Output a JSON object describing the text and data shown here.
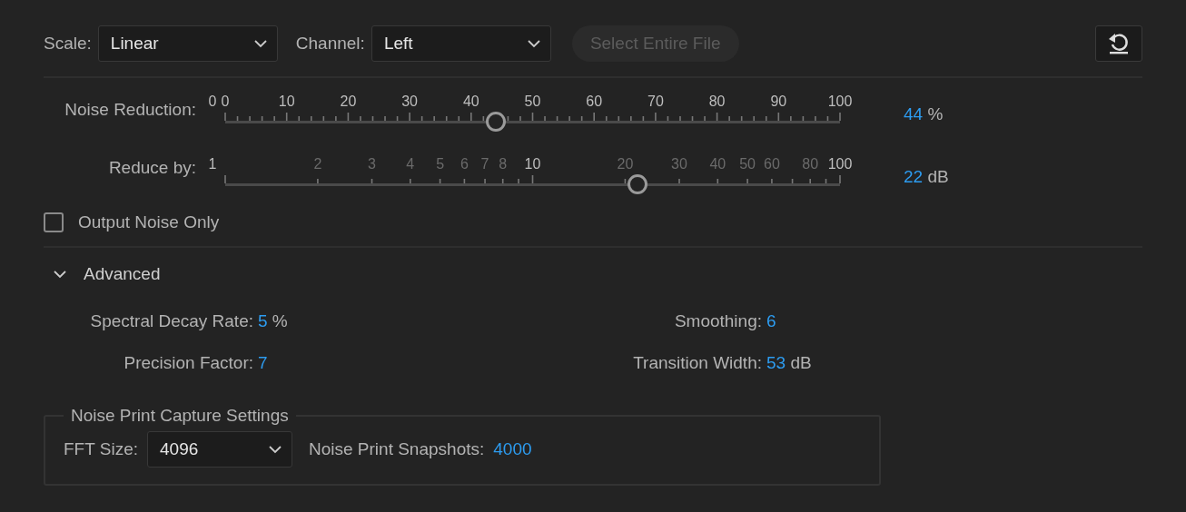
{
  "toolbar": {
    "scale": {
      "label": "Scale:",
      "value": "Linear"
    },
    "channel": {
      "label": "Channel:",
      "value": "Left"
    },
    "select_button": {
      "label": "Select Entire File",
      "disabled": true
    }
  },
  "sliders": [
    {
      "label": "Noise Reduction:",
      "kind": "linear",
      "outer_label": "0",
      "level": 0.44,
      "value": "44",
      "unit": "%",
      "tick_labels": [
        {
          "text": "0",
          "major": true
        },
        {
          "text": "10",
          "major": true
        },
        {
          "text": "20",
          "major": true
        },
        {
          "text": "30",
          "major": true
        },
        {
          "text": "40",
          "major": true
        },
        {
          "text": "50",
          "major": true
        },
        {
          "text": "60",
          "major": true
        },
        {
          "text": "70",
          "major": true
        },
        {
          "text": "80",
          "major": true
        },
        {
          "text": "90",
          "major": true
        },
        {
          "text": "100",
          "major": true
        }
      ]
    },
    {
      "label": "Reduce by:",
      "kind": "log",
      "outer_label": "1",
      "level": 0.671,
      "value": "22",
      "unit": "dB",
      "tick_labels": [
        {
          "text": "2",
          "major": false
        },
        {
          "text": "3",
          "major": false
        },
        {
          "text": "4",
          "major": false
        },
        {
          "text": "5",
          "major": false
        },
        {
          "text": "6",
          "major": false
        },
        {
          "text": "7",
          "major": false
        },
        {
          "text": "8",
          "major": false
        },
        {
          "text": "10",
          "major": true
        },
        {
          "text": "20",
          "major": false
        },
        {
          "text": "30",
          "major": false
        },
        {
          "text": "40",
          "major": false
        },
        {
          "text": "50",
          "major": false
        },
        {
          "text": "60",
          "major": false
        },
        {
          "text": "80",
          "major": false
        },
        {
          "text": "100",
          "major": true
        }
      ]
    }
  ],
  "output_noise_only": {
    "label": "Output Noise Only",
    "checked": false
  },
  "advanced": {
    "label": "Advanced",
    "expanded": true,
    "params": [
      {
        "label": "Spectral Decay Rate:",
        "value": "5",
        "unit": "%"
      },
      {
        "label": "Smoothing:",
        "value": "6"
      },
      {
        "label": "Precision Factor:",
        "value": "7"
      },
      {
        "label": "Transition Width:",
        "value": "53",
        "unit": "dB"
      }
    ]
  },
  "noise_print": {
    "title": "Noise Print Capture Settings",
    "fft": {
      "label": "FFT Size:",
      "value": "4096"
    },
    "snapshots": {
      "label": "Noise Print Snapshots:",
      "value": "4000"
    }
  }
}
